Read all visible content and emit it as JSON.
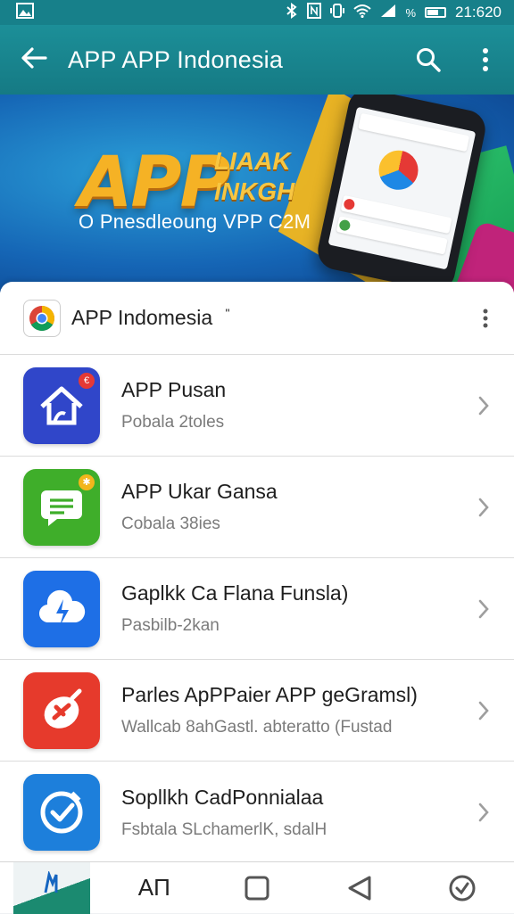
{
  "status_bar": {
    "time": "21:620",
    "signal_text": "%"
  },
  "toolbar": {
    "title": "APP APP Indonesia"
  },
  "banner": {
    "headline": "APP",
    "headline_side": [
      "LIAAK",
      "INKGH"
    ],
    "tagline": "O Pnesdleoung VPP C2M"
  },
  "section": {
    "title": "APP Indomesia",
    "suffix": "\""
  },
  "apps": [
    {
      "name": "APP Pusan",
      "desc": "Pobala 2toles",
      "icon": "home-icon",
      "color": "#3046c9",
      "badge_color": "#e53935",
      "badge": "€"
    },
    {
      "name": "APP Ukar Gansa",
      "desc": "Cobala 38ies",
      "icon": "chat-icon",
      "color": "#3fae2a",
      "badge_color": "#f2b61c",
      "badge": "✱"
    },
    {
      "name": "Gaplkk Ca Flana Funsla)",
      "desc": "Pasbilb-2kan",
      "icon": "cloud-bolt-icon",
      "color": "#1e6fe6",
      "badge_color": "",
      "badge": ""
    },
    {
      "name": "Parles ApPPaier APP geGramsl)",
      "desc": "Wallcab 8ahGastl. abteratto (Fustad",
      "icon": "plug-icon",
      "color": "#e63a2c",
      "badge_color": "",
      "badge": ""
    },
    {
      "name": "Sopllkh CadPonnialaa",
      "desc": "Fsbtala SLchamerlK, sdalH",
      "icon": "check-circle-icon",
      "color": "#1d7fdb",
      "badge_color": "",
      "badge": ""
    }
  ],
  "nav": {
    "label": "AП"
  }
}
